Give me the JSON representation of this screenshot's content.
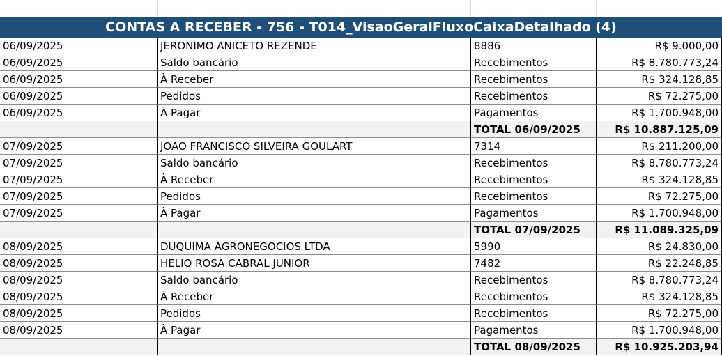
{
  "title": "CONTAS A RECEBER - 756 - T014_VisaoGeralFluxoCaixaDetalhado (4)",
  "colors": {
    "header_bg": "#1f4e79",
    "total_bg": "#f2f2f2"
  },
  "rows": [
    {
      "kind": "data",
      "date": "06/09/2025",
      "desc": "JERONIMO ANICETO REZENDE",
      "cat": "8886",
      "value": "R$ 9.000,00"
    },
    {
      "kind": "data",
      "date": "06/09/2025",
      "desc": "Saldo bancário",
      "cat": "Recebimentos",
      "value": "R$ 8.780.773,24"
    },
    {
      "kind": "data",
      "date": "06/09/2025",
      "desc": "À Receber",
      "cat": "Recebimentos",
      "value": "R$ 324.128,85"
    },
    {
      "kind": "data",
      "date": "06/09/2025",
      "desc": "Pedidos",
      "cat": "Recebimentos",
      "value": "R$ 72.275,00"
    },
    {
      "kind": "data",
      "date": "06/09/2025",
      "desc": "À Pagar",
      "cat": "Pagamentos",
      "value": "R$ 1.700.948,00"
    },
    {
      "kind": "total",
      "date": "",
      "desc": "",
      "cat": "TOTAL 06/09/2025",
      "value": "R$ 10.887.125,09"
    },
    {
      "kind": "data",
      "date": "07/09/2025",
      "desc": "JOAO FRANCISCO SILVEIRA GOULART",
      "cat": "7314",
      "value": "R$ 211.200,00"
    },
    {
      "kind": "data",
      "date": "07/09/2025",
      "desc": "Saldo bancário",
      "cat": "Recebimentos",
      "value": "R$ 8.780.773,24"
    },
    {
      "kind": "data",
      "date": "07/09/2025",
      "desc": "À Receber",
      "cat": "Recebimentos",
      "value": "R$ 324.128,85"
    },
    {
      "kind": "data",
      "date": "07/09/2025",
      "desc": "Pedidos",
      "cat": "Recebimentos",
      "value": "R$ 72.275,00"
    },
    {
      "kind": "data",
      "date": "07/09/2025",
      "desc": "À Pagar",
      "cat": "Pagamentos",
      "value": "R$ 1.700.948,00"
    },
    {
      "kind": "total",
      "date": "",
      "desc": "",
      "cat": "TOTAL 07/09/2025",
      "value": "R$ 11.089.325,09"
    },
    {
      "kind": "data",
      "date": "08/09/2025",
      "desc": "DUQUIMA AGRONEGOCIOS LTDA",
      "cat": "5990",
      "value": "R$ 24.830,00"
    },
    {
      "kind": "data",
      "date": "08/09/2025",
      "desc": "HELIO ROSA CABRAL JUNIOR",
      "cat": "7482",
      "value": "R$ 22.248,85"
    },
    {
      "kind": "data",
      "date": "08/09/2025",
      "desc": "Saldo bancário",
      "cat": "Recebimentos",
      "value": "R$ 8.780.773,24"
    },
    {
      "kind": "data",
      "date": "08/09/2025",
      "desc": "À Receber",
      "cat": "Recebimentos",
      "value": "R$ 324.128,85"
    },
    {
      "kind": "data",
      "date": "08/09/2025",
      "desc": "Pedidos",
      "cat": "Recebimentos",
      "value": "R$ 72.275,00"
    },
    {
      "kind": "data",
      "date": "08/09/2025",
      "desc": "À Pagar",
      "cat": "Pagamentos",
      "value": "R$ 1.700.948,00"
    },
    {
      "kind": "total",
      "date": "",
      "desc": "",
      "cat": "TOTAL 08/09/2025",
      "value": "R$ 10.925.203,94"
    }
  ]
}
